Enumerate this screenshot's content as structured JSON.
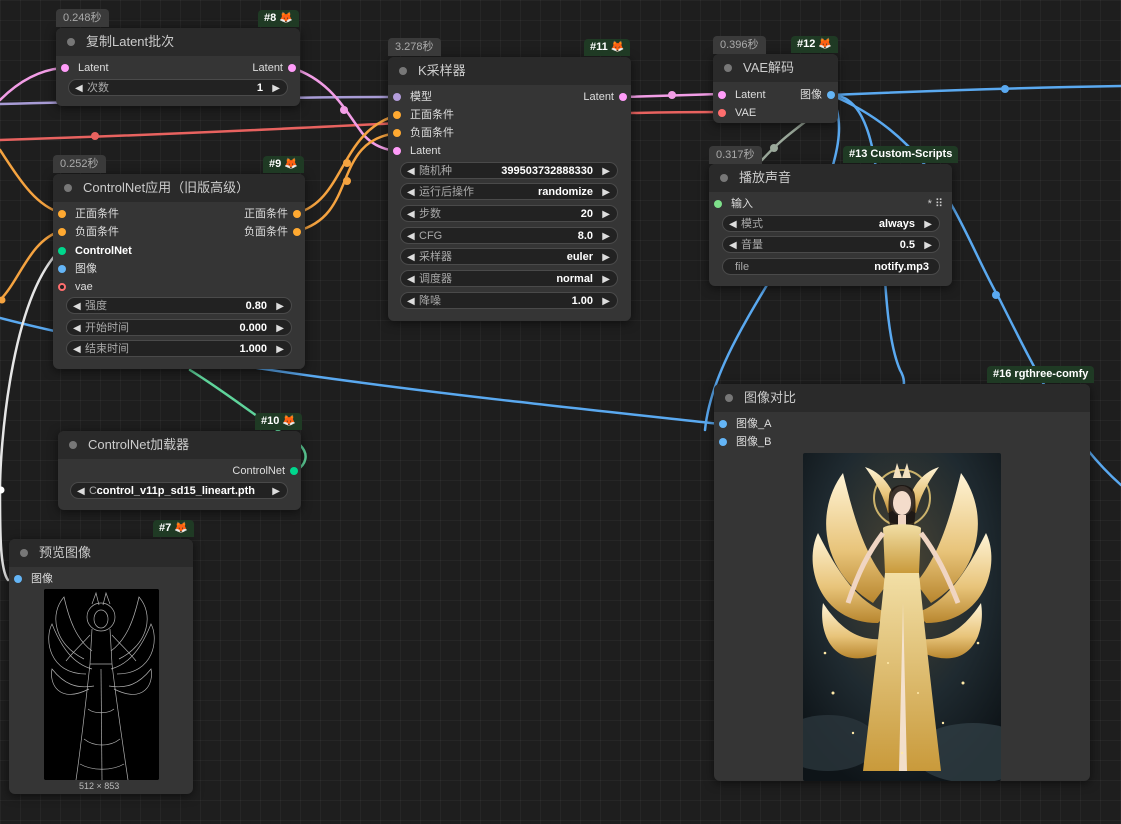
{
  "colors": {
    "latent": "#ff9cf9",
    "conditioning": "#ffa931",
    "model": "#b39ddb",
    "vae": "#ff6e6e",
    "controlnet": "#00d78d",
    "image": "#64b5f6",
    "wire_image": "#5aa9f0",
    "wire_cond": "#f5a340",
    "wire_vae": "#e8625f",
    "wire_latent": "#f29de6",
    "wire_controlnet": "#5fd49b"
  },
  "nodes": {
    "duplicate_latent": {
      "timing": "0.248秒",
      "id": "#8",
      "title": "复制Latent批次",
      "input_latent": "Latent",
      "output_latent": "Latent",
      "widget_label": "次数",
      "widget_value": "1"
    },
    "ksampler": {
      "timing": "3.278秒",
      "id": "#11",
      "title": "K采样器",
      "inputs": [
        "模型",
        "正面条件",
        "负面条件",
        "Latent"
      ],
      "output": "Latent",
      "widgets": [
        {
          "label": "随机种",
          "value": "399503732888330"
        },
        {
          "label": "运行后操作",
          "value": "randomize"
        },
        {
          "label": "步数",
          "value": "20"
        },
        {
          "label": "CFG",
          "value": "8.0"
        },
        {
          "label": "采样器",
          "value": "euler"
        },
        {
          "label": "调度器",
          "value": "normal"
        },
        {
          "label": "降噪",
          "value": "1.00"
        }
      ]
    },
    "vae_decode": {
      "timing": "0.396秒",
      "id": "#12",
      "title": "VAE解码",
      "input_latent": "Latent",
      "input_vae": "VAE",
      "output_image": "图像"
    },
    "controlnet_apply": {
      "timing": "0.252秒",
      "id": "#9",
      "title": "ControlNet应用（旧版高级）",
      "inputs": [
        "正面条件",
        "负面条件",
        "ControlNet",
        "图像",
        "vae"
      ],
      "outputs": [
        "正面条件",
        "负面条件"
      ],
      "widgets": [
        {
          "label": "强度",
          "value": "0.80"
        },
        {
          "label": "开始时间",
          "value": "0.000"
        },
        {
          "label": "结束时间",
          "value": "1.000"
        }
      ]
    },
    "play_sound": {
      "timing": "0.317秒",
      "id": "#13 Custom-Scripts",
      "title": "播放声音",
      "input": "输入",
      "input_marker": "*",
      "widgets": [
        {
          "label": "模式",
          "value": "always"
        },
        {
          "label": "音量",
          "value": "0.5"
        },
        {
          "label": "file",
          "value": "notify.mp3"
        }
      ]
    },
    "controlnet_loader": {
      "id": "#10",
      "title": "ControlNet加载器",
      "output": "ControlNet",
      "widget_label": "C ...",
      "widget_value": "control_v11p_sd15_lineart.pth"
    },
    "image_compare": {
      "id": "#16 rgthree-comfy",
      "title": "图像对比",
      "inputs": [
        "图像_A",
        "图像_B"
      ]
    },
    "preview_image": {
      "id": "#7",
      "title": "预览图像",
      "input": "图像",
      "size_label": "512 × 853"
    }
  }
}
